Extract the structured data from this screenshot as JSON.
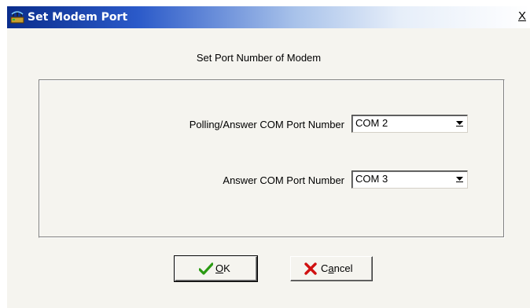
{
  "window": {
    "title": "Set Modem Port",
    "close_label": "X"
  },
  "subtitle": "Set Port Number of Modem",
  "fields": [
    {
      "label": "Polling/Answer COM Port Number",
      "value": "COM 2"
    },
    {
      "label": "Answer COM Port Number",
      "value": "COM 3"
    }
  ],
  "buttons": {
    "ok": {
      "accel": "O",
      "rest": "K"
    },
    "cancel": {
      "accel": "a",
      "before": "C",
      "rest": "ncel"
    }
  },
  "icons": {
    "app": "modem-icon",
    "ok": "check-icon",
    "cancel": "x-icon",
    "dropdown": "chevron-down-icon"
  },
  "colors": {
    "title_bar_start": "#0a2d8c",
    "check": "#2a9a12",
    "cancel_x": "#d01010"
  }
}
